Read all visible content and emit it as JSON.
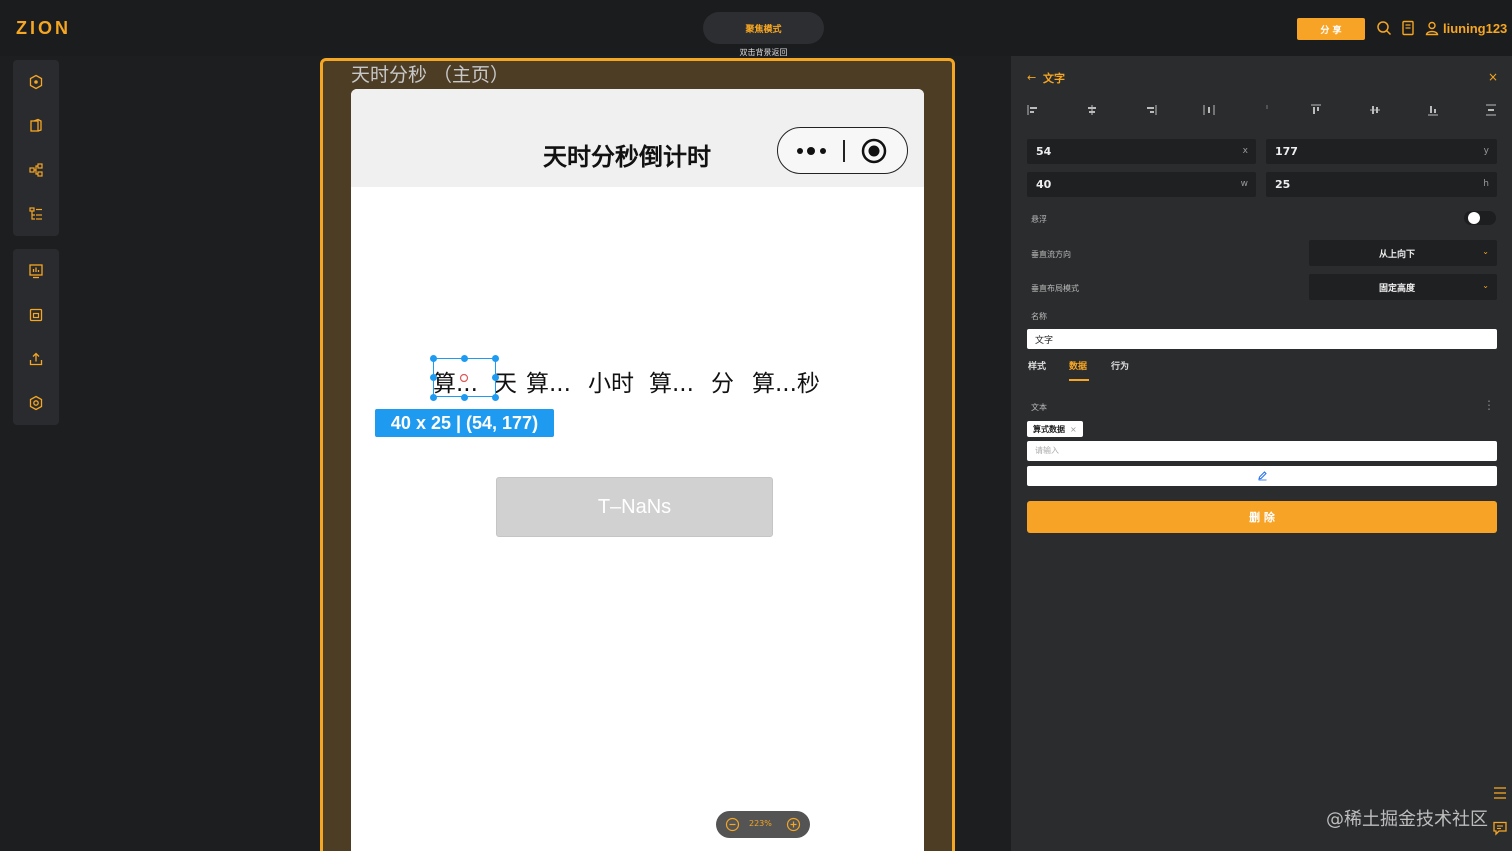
{
  "topbar": {
    "logo": "ZION",
    "focus_mode": "聚焦模式",
    "focus_hint": "双击背景返回",
    "share": "分 享",
    "username": "liuning123"
  },
  "canvas": {
    "page_title": "天时分秒 （主页）",
    "app_title": "天时分秒倒计时",
    "countdown_row": [
      "算...",
      "天",
      "算...",
      "小时",
      "算...",
      "分",
      "算...秒"
    ],
    "selection_info": "40 x 25 | (54, 177)",
    "button_label": "T–NaNs",
    "zoom": "223%"
  },
  "panel": {
    "title": "文字",
    "x": "54",
    "x_unit": "x",
    "y": "177",
    "y_unit": "y",
    "w": "40",
    "w_unit": "w",
    "h": "25",
    "h_unit": "h",
    "float_label": "悬浮",
    "float_on": false,
    "vflow_label": "垂直流方向",
    "vflow_value": "从上向下",
    "vlayout_label": "垂直布局模式",
    "vlayout_value": "固定高度",
    "name_label": "名称",
    "name_value": "文字",
    "tabs": [
      "样式",
      "数据",
      "行为"
    ],
    "active_tab": "数据",
    "text_label": "文本",
    "chip": "算式数据",
    "text_placeholder": "请输入",
    "delete": "删 除"
  },
  "watermark": "@稀土掘金技术社区",
  "colors": {
    "accent": "#f5a623",
    "selection": "#1e9bf0",
    "panel": "#2b2c2e",
    "frame": "#4d3d25"
  }
}
